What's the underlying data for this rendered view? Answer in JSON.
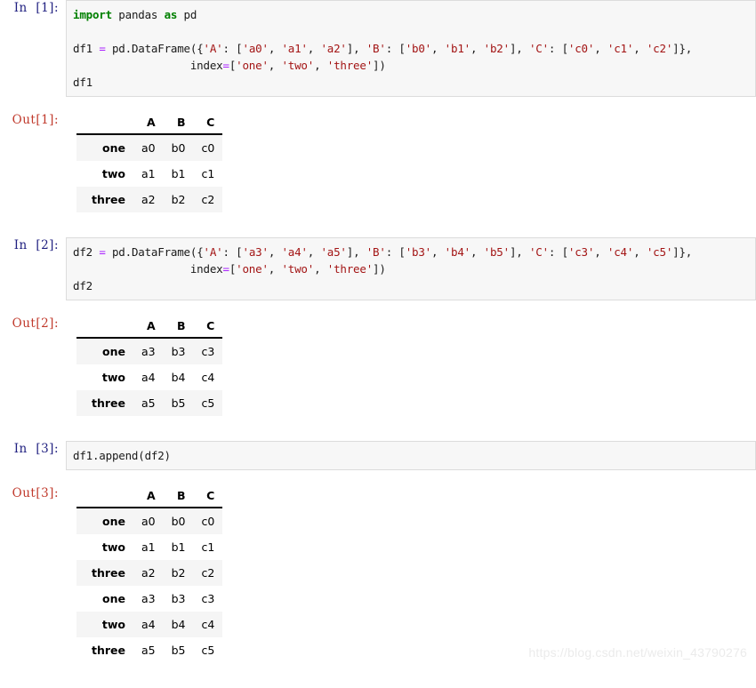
{
  "notebook": {
    "cells": [
      {
        "type": "input",
        "prompt": "In  [1]:",
        "lines": [
          [
            {
              "t": "import",
              "c": "kw"
            },
            {
              "t": " pandas ",
              "c": "plain"
            },
            {
              "t": "as",
              "c": "kw"
            },
            {
              "t": " pd",
              "c": "plain"
            }
          ],
          [],
          [
            {
              "t": "df1 ",
              "c": "plain"
            },
            {
              "t": "=",
              "c": "op"
            },
            {
              "t": " pd.DataFrame({",
              "c": "plain"
            },
            {
              "t": "'A'",
              "c": "str"
            },
            {
              "t": ": [",
              "c": "plain"
            },
            {
              "t": "'a0'",
              "c": "str"
            },
            {
              "t": ", ",
              "c": "plain"
            },
            {
              "t": "'a1'",
              "c": "str"
            },
            {
              "t": ", ",
              "c": "plain"
            },
            {
              "t": "'a2'",
              "c": "str"
            },
            {
              "t": "], ",
              "c": "plain"
            },
            {
              "t": "'B'",
              "c": "str"
            },
            {
              "t": ": [",
              "c": "plain"
            },
            {
              "t": "'b0'",
              "c": "str"
            },
            {
              "t": ", ",
              "c": "plain"
            },
            {
              "t": "'b1'",
              "c": "str"
            },
            {
              "t": ", ",
              "c": "plain"
            },
            {
              "t": "'b2'",
              "c": "str"
            },
            {
              "t": "], ",
              "c": "plain"
            },
            {
              "t": "'C'",
              "c": "str"
            },
            {
              "t": ": [",
              "c": "plain"
            },
            {
              "t": "'c0'",
              "c": "str"
            },
            {
              "t": ", ",
              "c": "plain"
            },
            {
              "t": "'c1'",
              "c": "str"
            },
            {
              "t": ", ",
              "c": "plain"
            },
            {
              "t": "'c2'",
              "c": "str"
            },
            {
              "t": "]},",
              "c": "plain"
            }
          ],
          [
            {
              "t": "                  index",
              "c": "plain"
            },
            {
              "t": "=",
              "c": "op"
            },
            {
              "t": "[",
              "c": "plain"
            },
            {
              "t": "'one'",
              "c": "str"
            },
            {
              "t": ", ",
              "c": "plain"
            },
            {
              "t": "'two'",
              "c": "str"
            },
            {
              "t": ", ",
              "c": "plain"
            },
            {
              "t": "'three'",
              "c": "str"
            },
            {
              "t": "])",
              "c": "plain"
            }
          ],
          [
            {
              "t": "df1",
              "c": "plain"
            }
          ]
        ]
      },
      {
        "type": "output",
        "prompt": "Out[1]:",
        "table": {
          "corner": "",
          "columns": [
            "A",
            "B",
            "C"
          ],
          "index": [
            "one",
            "two",
            "three"
          ],
          "rows": [
            [
              "a0",
              "b0",
              "c0"
            ],
            [
              "a1",
              "b1",
              "c1"
            ],
            [
              "a2",
              "b2",
              "c2"
            ]
          ]
        }
      },
      {
        "type": "input",
        "prompt": "In  [2]:",
        "lines": [
          [
            {
              "t": "df2 ",
              "c": "plain"
            },
            {
              "t": "=",
              "c": "op"
            },
            {
              "t": " pd.DataFrame({",
              "c": "plain"
            },
            {
              "t": "'A'",
              "c": "str"
            },
            {
              "t": ": [",
              "c": "plain"
            },
            {
              "t": "'a3'",
              "c": "str"
            },
            {
              "t": ", ",
              "c": "plain"
            },
            {
              "t": "'a4'",
              "c": "str"
            },
            {
              "t": ", ",
              "c": "plain"
            },
            {
              "t": "'a5'",
              "c": "str"
            },
            {
              "t": "], ",
              "c": "plain"
            },
            {
              "t": "'B'",
              "c": "str"
            },
            {
              "t": ": [",
              "c": "plain"
            },
            {
              "t": "'b3'",
              "c": "str"
            },
            {
              "t": ", ",
              "c": "plain"
            },
            {
              "t": "'b4'",
              "c": "str"
            },
            {
              "t": ", ",
              "c": "plain"
            },
            {
              "t": "'b5'",
              "c": "str"
            },
            {
              "t": "], ",
              "c": "plain"
            },
            {
              "t": "'C'",
              "c": "str"
            },
            {
              "t": ": [",
              "c": "plain"
            },
            {
              "t": "'c3'",
              "c": "str"
            },
            {
              "t": ", ",
              "c": "plain"
            },
            {
              "t": "'c4'",
              "c": "str"
            },
            {
              "t": ", ",
              "c": "plain"
            },
            {
              "t": "'c5'",
              "c": "str"
            },
            {
              "t": "]},",
              "c": "plain"
            }
          ],
          [
            {
              "t": "                  index",
              "c": "plain"
            },
            {
              "t": "=",
              "c": "op"
            },
            {
              "t": "[",
              "c": "plain"
            },
            {
              "t": "'one'",
              "c": "str"
            },
            {
              "t": ", ",
              "c": "plain"
            },
            {
              "t": "'two'",
              "c": "str"
            },
            {
              "t": ", ",
              "c": "plain"
            },
            {
              "t": "'three'",
              "c": "str"
            },
            {
              "t": "])",
              "c": "plain"
            }
          ],
          [
            {
              "t": "df2",
              "c": "plain"
            }
          ]
        ]
      },
      {
        "type": "output",
        "prompt": "Out[2]:",
        "table": {
          "corner": "",
          "columns": [
            "A",
            "B",
            "C"
          ],
          "index": [
            "one",
            "two",
            "three"
          ],
          "rows": [
            [
              "a3",
              "b3",
              "c3"
            ],
            [
              "a4",
              "b4",
              "c4"
            ],
            [
              "a5",
              "b5",
              "c5"
            ]
          ]
        }
      },
      {
        "type": "input",
        "prompt": "In  [3]:",
        "lines": [
          [
            {
              "t": "df1.append(df2)",
              "c": "plain"
            }
          ]
        ]
      },
      {
        "type": "output",
        "prompt": "Out[3]:",
        "table": {
          "corner": "",
          "columns": [
            "A",
            "B",
            "C"
          ],
          "index": [
            "one",
            "two",
            "three",
            "one",
            "two",
            "three"
          ],
          "rows": [
            [
              "a0",
              "b0",
              "c0"
            ],
            [
              "a1",
              "b1",
              "c1"
            ],
            [
              "a2",
              "b2",
              "c2"
            ],
            [
              "a3",
              "b3",
              "c3"
            ],
            [
              "a4",
              "b4",
              "c4"
            ],
            [
              "a5",
              "b5",
              "c5"
            ]
          ]
        }
      }
    ]
  },
  "watermark": {
    "text": "https://blog.csdn.net/weixin_43790276"
  },
  "colors": {
    "in_prompt": "#202080",
    "out_prompt": "#c0392b",
    "keyword": "#008000",
    "string": "#a31515",
    "operator": "#aa22ff",
    "cell_background": "#f7f7f7",
    "cell_border": "#dcdcdc",
    "row_stripe": "#f5f5f5",
    "watermark": "#ebebeb"
  }
}
